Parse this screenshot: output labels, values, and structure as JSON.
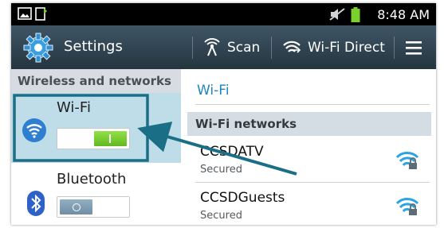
{
  "status_bar": {
    "time": "8:48 AM",
    "icons": [
      "gallery-icon",
      "download-icon",
      "mute-icon",
      "battery-icon"
    ]
  },
  "action_bar": {
    "title": "Settings",
    "scan_label": "Scan",
    "wifi_direct_label": "Wi-Fi Direct",
    "icons": [
      "settings-gear-icon",
      "scan-icon",
      "wifi-direct-icon",
      "menu-icon"
    ]
  },
  "left_pane": {
    "section_header": "Wireless and networks",
    "items": [
      {
        "label": "Wi-Fi",
        "icon": "wifi-icon",
        "toggle_on": true,
        "selected": true
      },
      {
        "label": "Bluetooth",
        "icon": "bluetooth-icon",
        "toggle_on": false,
        "selected": false
      }
    ]
  },
  "right_pane": {
    "title": "Wi-Fi",
    "section_header": "Wi-Fi networks",
    "networks": [
      {
        "name": "CCSDATV",
        "status": "Secured",
        "icon": "wifi-secured-icon"
      },
      {
        "name": "CCSDGuests",
        "status": "Secured",
        "icon": "wifi-secured-icon"
      }
    ]
  },
  "colors": {
    "action_bar": "#2e404c",
    "toggle_on": "#7ad12c",
    "toggle_off": "#7e9bb0",
    "callout": "#1a6f86",
    "selected_item": "#bfdde9",
    "accent_text": "#1f86bf"
  }
}
